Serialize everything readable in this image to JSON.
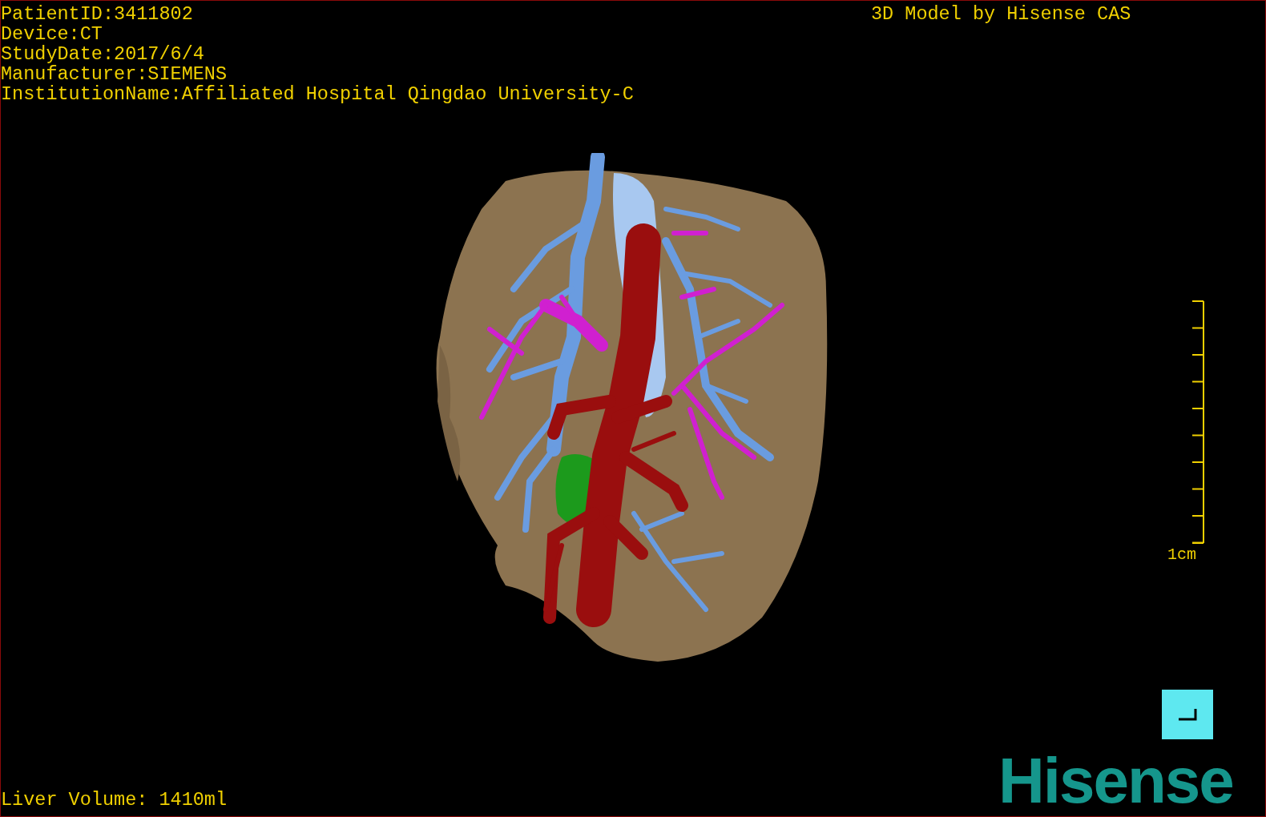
{
  "info_lines": [
    "PatientID:3411802",
    "Device:CT",
    "StudyDate:2017/6/4",
    "Manufacturer:SIEMENS",
    "InstitutionName:Affiliated Hospital Qingdao University-C"
  ],
  "model_credit": "3D Model by Hisense CAS",
  "scale_bar": {
    "label": "1cm"
  },
  "liver_volume": "Liver Volume: 1410ml",
  "logo": "Hisense"
}
